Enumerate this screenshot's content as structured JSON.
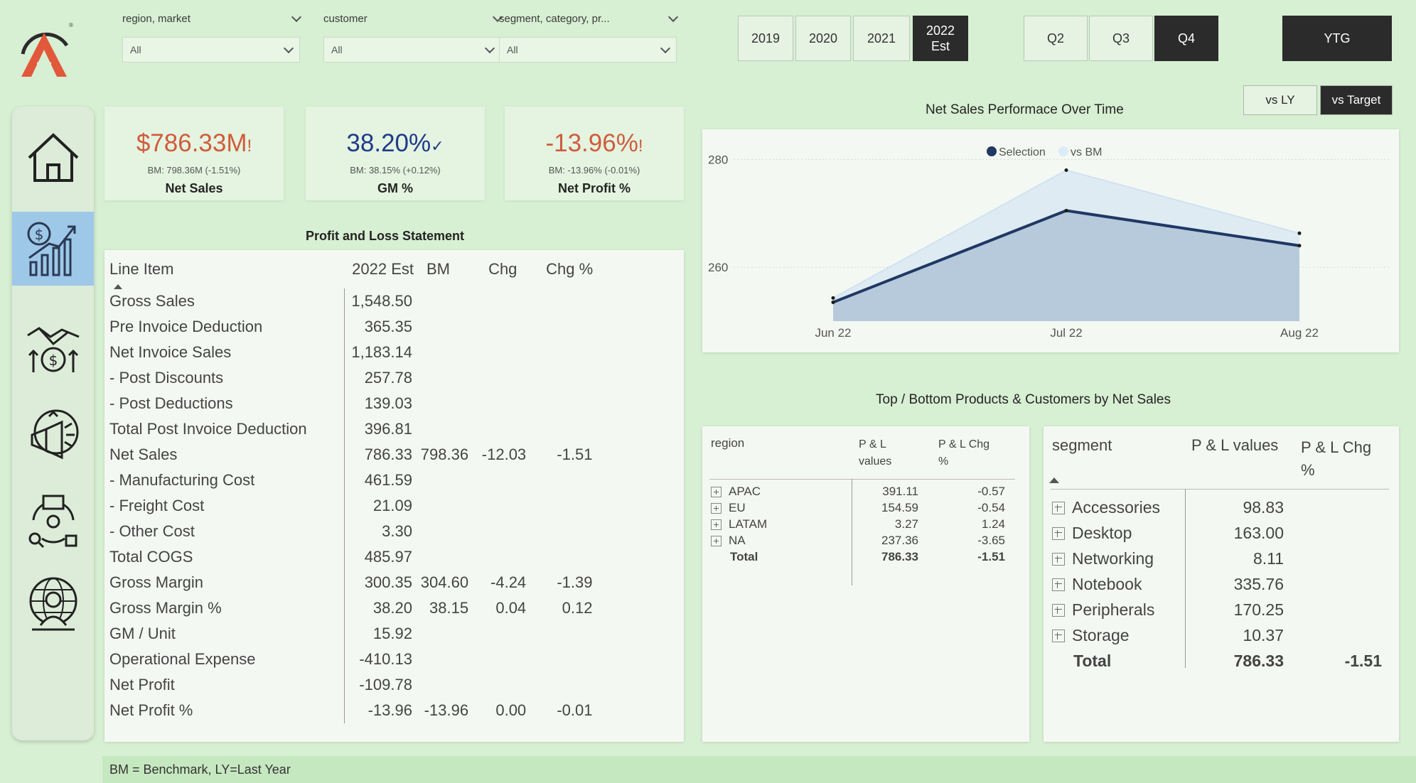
{
  "filters": [
    {
      "label": "region, market",
      "value": "All"
    },
    {
      "label": "customer",
      "value": "All"
    },
    {
      "label": "segment, category, pr...",
      "value": "All"
    }
  ],
  "years": [
    {
      "label": "2019",
      "active": false
    },
    {
      "label": "2020",
      "active": false
    },
    {
      "label": "2021",
      "active": false
    },
    {
      "label": "2022",
      "sub": "Est",
      "active": true
    }
  ],
  "quarters": [
    {
      "label": "Q2",
      "active": false
    },
    {
      "label": "Q3",
      "active": false
    },
    {
      "label": "Q4",
      "active": true
    }
  ],
  "ytg_label": "YTG",
  "nav_icons": [
    "home-icon",
    "finance-growth-icon",
    "handshake-money-icon",
    "marketing-megaphone-icon",
    "supply-chain-icon",
    "global-person-icon"
  ],
  "kpis": [
    {
      "value": "$786.33M",
      "flag": "!",
      "bm": "BM: 798.36M (-1.51%)",
      "label": "Net Sales",
      "color": "#d05b3c"
    },
    {
      "value": "38.20%",
      "flag": "✓",
      "bm": "BM: 38.15% (+0.12%)",
      "label": "GM %",
      "color": "#1f3a8a"
    },
    {
      "value": "-13.96%",
      "flag": "!",
      "bm": "BM: -13.96% (-0.01%)",
      "label": "Net Profit %",
      "color": "#d05b3c"
    }
  ],
  "pl": {
    "title": "Profit and Loss Statement",
    "headers": [
      "Line Item",
      "2022 Est",
      "BM",
      "Chg",
      "Chg %"
    ],
    "rows": [
      [
        "Gross Sales",
        "1,548.50",
        "",
        "",
        ""
      ],
      [
        "Pre Invoice Deduction",
        "365.35",
        "",
        "",
        ""
      ],
      [
        "Net Invoice Sales",
        "1,183.14",
        "",
        "",
        ""
      ],
      [
        "- Post Discounts",
        "257.78",
        "",
        "",
        ""
      ],
      [
        "- Post Deductions",
        "139.03",
        "",
        "",
        ""
      ],
      [
        "Total Post Invoice Deduction",
        "396.81",
        "",
        "",
        ""
      ],
      [
        "Net Sales",
        "786.33",
        "798.36",
        "-12.03",
        "-1.51"
      ],
      [
        "- Manufacturing Cost",
        "461.59",
        "",
        "",
        ""
      ],
      [
        "- Freight Cost",
        "21.09",
        "",
        "",
        ""
      ],
      [
        "- Other Cost",
        "3.30",
        "",
        "",
        ""
      ],
      [
        "Total COGS",
        "485.97",
        "",
        "",
        ""
      ],
      [
        "Gross Margin",
        "300.35",
        "304.60",
        "-4.24",
        "-1.39"
      ],
      [
        "Gross Margin %",
        "38.20",
        "38.15",
        "0.04",
        "0.12"
      ],
      [
        "GM / Unit",
        "15.92",
        "",
        "",
        ""
      ],
      [
        "Operational Expense",
        "-410.13",
        "",
        "",
        ""
      ],
      [
        "Net Profit",
        "-109.78",
        "",
        "",
        ""
      ],
      [
        "Net Profit %",
        "-13.96",
        "-13.96",
        "0.00",
        "-0.01"
      ]
    ]
  },
  "toggles": [
    {
      "label": "vs LY",
      "active": false
    },
    {
      "label": "vs Target",
      "active": true
    }
  ],
  "chart_title": "Net Sales Performace Over Time",
  "chart_data": {
    "type": "area",
    "x": [
      "Jun 22",
      "Jul 22",
      "Aug 22"
    ],
    "series": [
      {
        "name": "Selection",
        "values": [
          253.5,
          270.5,
          264
        ],
        "color": "#1f3864"
      },
      {
        "name": "vs BM",
        "values": [
          254.3,
          278,
          266.3
        ],
        "color": "#dcebf7"
      }
    ],
    "yticks": [
      260,
      280
    ],
    "ylim": [
      250,
      284
    ],
    "legend": "top-center"
  },
  "products_title": "Top / Bottom Products & Customers by Net Sales",
  "region_table": {
    "headers": [
      "region",
      "P & L values",
      "P & L Chg %"
    ],
    "rows": [
      [
        "APAC",
        "391.11",
        "-0.57"
      ],
      [
        "EU",
        "154.59",
        "-0.54"
      ],
      [
        "LATAM",
        "3.27",
        "1.24"
      ],
      [
        "NA",
        "237.36",
        "-3.65"
      ]
    ],
    "total": [
      "Total",
      "786.33",
      "-1.51"
    ]
  },
  "segment_table": {
    "headers": [
      "segment",
      "P & L values",
      "P & L Chg %"
    ],
    "rows": [
      [
        "Accessories",
        "98.83",
        ""
      ],
      [
        "Desktop",
        "163.00",
        ""
      ],
      [
        "Networking",
        "8.11",
        ""
      ],
      [
        "Notebook",
        "335.76",
        ""
      ],
      [
        "Peripherals",
        "170.25",
        ""
      ],
      [
        "Storage",
        "10.37",
        ""
      ]
    ],
    "total": [
      "Total",
      "786.33",
      "-1.51"
    ]
  },
  "footer": "BM = Benchmark, LY=Last Year"
}
